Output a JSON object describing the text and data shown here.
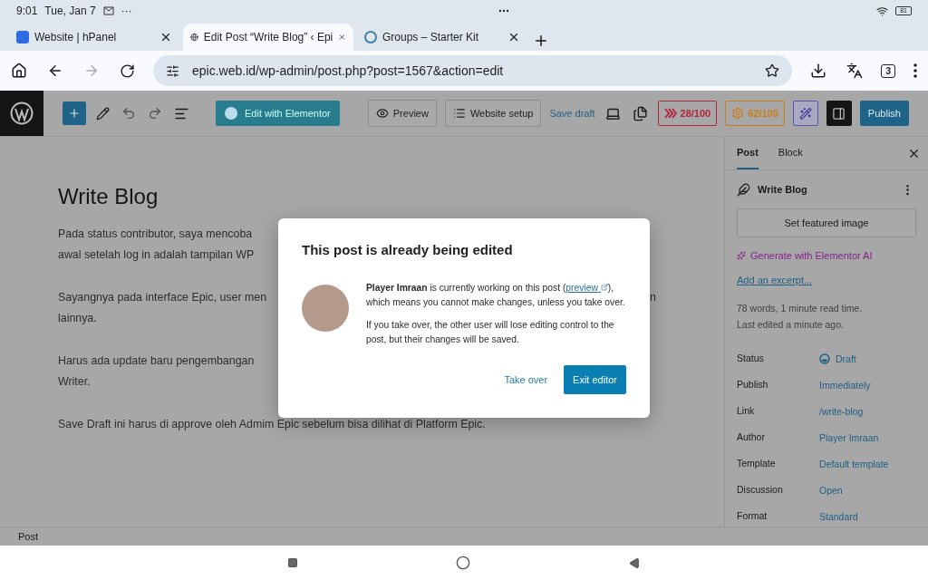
{
  "device_status": {
    "time": "9:01",
    "date": "Tue, Jan 7",
    "more": "···",
    "battery": "81"
  },
  "browser_tabs": [
    {
      "kind": "panel",
      "title": "Website | hPanel",
      "selected": false
    },
    {
      "kind": "globe",
      "title": "Edit Post “Write Blog” ‹ Epi",
      "selected": true
    },
    {
      "kind": "wp",
      "title": "Groups – Starter Kit",
      "selected": false
    }
  ],
  "address_bar": {
    "url": "epic.web.id/wp-admin/post.php?post=1567&action=edit",
    "tab_count": "3"
  },
  "toolbar": {
    "elementor": "Edit with Elementor",
    "preview": "Preview",
    "website_setup": "Website setup",
    "save_draft": "Save draft",
    "publish": "Publish",
    "scores": [
      {
        "kind": "m",
        "value": "28/100",
        "color": "#b3263a"
      },
      {
        "kind": "gear",
        "value": "62/100",
        "color": "#c97d12"
      }
    ]
  },
  "editor": {
    "title": "Write Blog",
    "paragraphs": [
      {
        "lines": [
          {
            "left": "Pada status contributor, saya mencoba"
          },
          {
            "left": "awal setelah log in adalah tampilan WP"
          }
        ]
      },
      {
        "lines": [
          {
            "left": "Sayangnya pada interface Epic, user men",
            "right": "n"
          },
          {
            "left": "lainnya."
          }
        ]
      },
      {
        "lines": [
          {
            "left": "Harus ada update baru pengembangan"
          },
          {
            "left": "Writer."
          }
        ]
      },
      {
        "lines": [
          {
            "left": "Save Draft ini harus di approve oleh Admim Epic sebelum bisa dilihat di Platform Epic."
          }
        ]
      }
    ]
  },
  "modal": {
    "title": "This post is already being edited",
    "message_start": "**Player Imraan** is currently working on this post (",
    "preview_link": "preview",
    "message_end": "), which means you cannot make changes, unless you take over.",
    "note": "If you take over, the other user will lose editing control to the post, but their changes will be saved.",
    "take_over": "Take over",
    "exit": "Exit editor"
  },
  "sidebar": {
    "tabs": [
      {
        "label": "Post",
        "selected": true
      },
      {
        "label": "Block",
        "selected": false
      }
    ],
    "post_title": "Write Blog",
    "featured_image": "Set featured image",
    "generate_ai": "Generate with Elementor AI",
    "excerpt": "Add an excerpt...",
    "stats": [
      "78 words, 1 minute read time.",
      "Last edited a minute ago."
    ],
    "fields": [
      {
        "kind": "status",
        "label": "Status",
        "value": "Draft"
      },
      {
        "kind": "plain",
        "label": "Publish",
        "value": "Immediately"
      },
      {
        "kind": "plain",
        "label": "Link",
        "value": "/write-blog"
      },
      {
        "kind": "plain",
        "label": "Author",
        "value": "Player Imraan"
      },
      {
        "kind": "plain",
        "label": "Template",
        "value": "Default template"
      },
      {
        "kind": "plain",
        "label": "Discussion",
        "value": "Open"
      },
      {
        "kind": "plain",
        "label": "Format",
        "value": "Standard"
      }
    ]
  },
  "footer": {
    "breadcrumb": "Post"
  }
}
